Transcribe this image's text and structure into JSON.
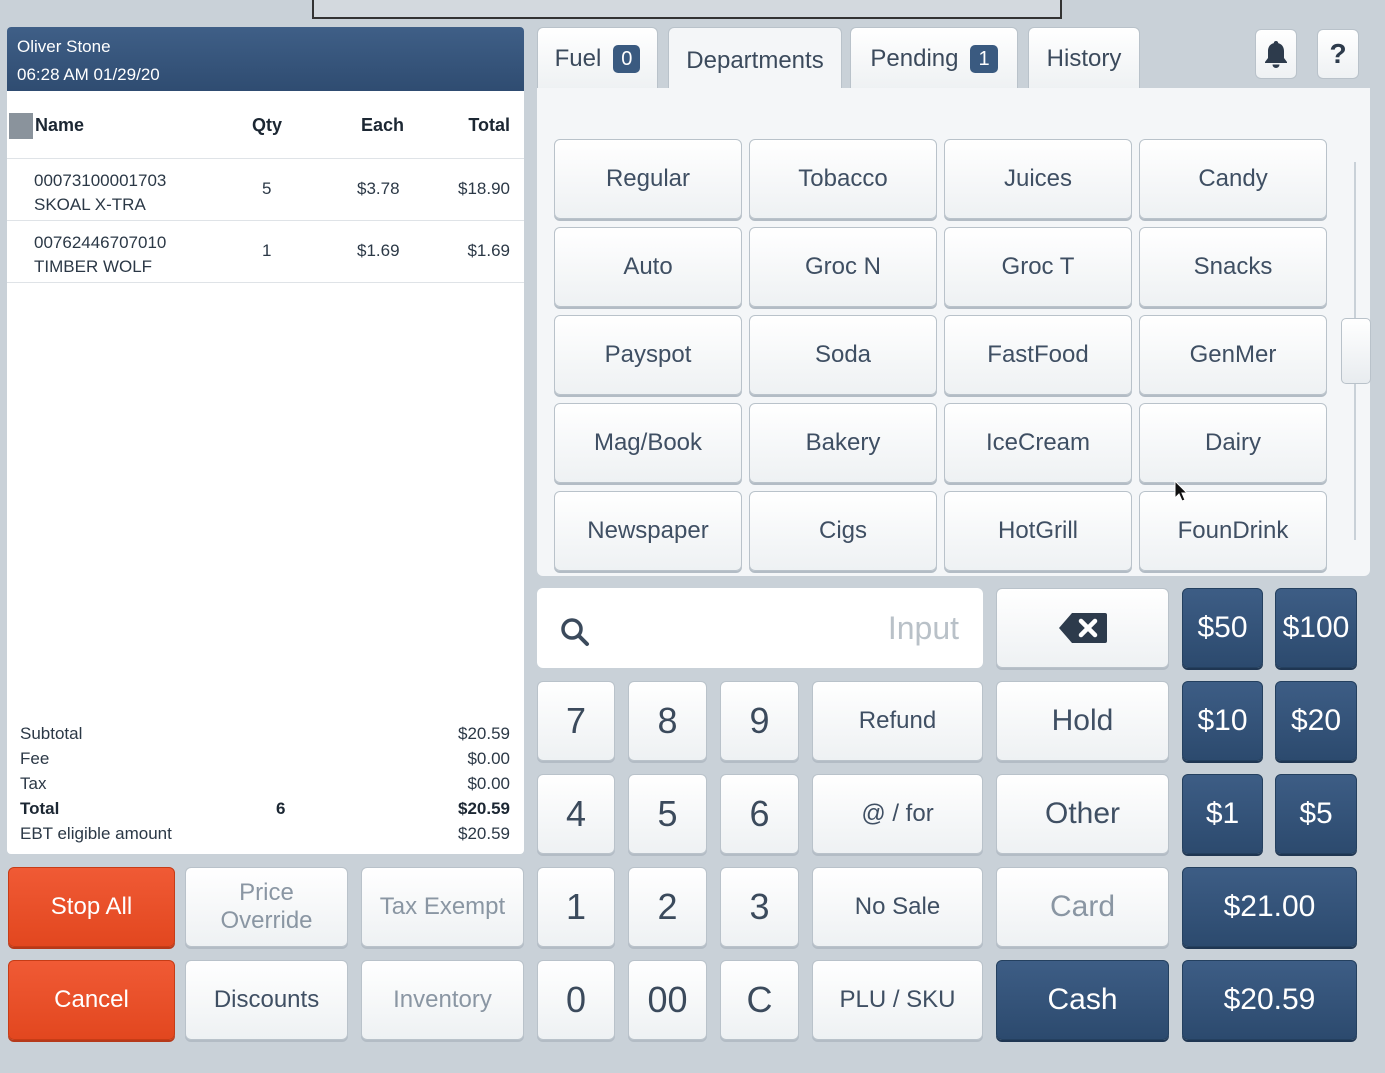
{
  "header": {
    "user": "Oliver Stone",
    "datetime": "06:28 AM 01/29/20"
  },
  "columns": {
    "name": "Name",
    "qty": "Qty",
    "each": "Each",
    "total": "Total"
  },
  "items": [
    {
      "code": "00073100001703",
      "name": "SKOAL X-TRA",
      "qty": "5",
      "each": "$3.78",
      "total": "$18.90"
    },
    {
      "code": "00762446707010",
      "name": "TIMBER WOLF",
      "qty": "1",
      "each": "$1.69",
      "total": "$1.69"
    }
  ],
  "totals": {
    "subtotal_label": "Subtotal",
    "subtotal": "$20.59",
    "fee_label": "Fee",
    "fee": "$0.00",
    "tax_label": "Tax",
    "tax": "$0.00",
    "total_label": "Total",
    "total_qty": "6",
    "total": "$20.59",
    "ebt_label": "EBT eligible amount",
    "ebt": "$20.59"
  },
  "tabs": {
    "fuel": "Fuel",
    "fuel_count": "0",
    "departments": "Departments",
    "pending": "Pending",
    "pending_count": "1",
    "history": "History",
    "help": "?"
  },
  "departments": [
    "Regular",
    "Tobacco",
    "Juices",
    "Candy",
    "Auto",
    "Groc N",
    "Groc T",
    "Snacks",
    "Payspot",
    "Soda",
    "FastFood",
    "GenMer",
    "Mag/Book",
    "Bakery",
    "IceCream",
    "Dairy",
    "Newspaper",
    "Cigs",
    "HotGrill",
    "FounDrink"
  ],
  "input": {
    "placeholder": "Input"
  },
  "keypad": {
    "k7": "7",
    "k8": "8",
    "k9": "9",
    "k4": "4",
    "k5": "5",
    "k6": "6",
    "k1": "1",
    "k2": "2",
    "k3": "3",
    "k0": "0",
    "k00": "00",
    "kc": "C"
  },
  "functions": {
    "refund": "Refund",
    "at_for": "@ / for",
    "no_sale": "No Sale",
    "plu_sku": "PLU / SKU",
    "hold": "Hold",
    "other": "Other",
    "card": "Card",
    "cash": "Cash",
    "stop_all": "Stop All",
    "price_override_1": "Price",
    "price_override_2": "Override",
    "tax_exempt": "Tax Exempt",
    "cancel": "Cancel",
    "discounts": "Discounts",
    "inventory": "Inventory"
  },
  "quick_cash": {
    "q50": "$50",
    "q100": "$100",
    "q10": "$10",
    "q20": "$20",
    "q1": "$1",
    "q5": "$5",
    "q21": "$21.00",
    "exact": "$20.59"
  },
  "colors": {
    "navy": "#2f4c71",
    "red": "#e94e28",
    "panel": "#f4f6f8"
  }
}
